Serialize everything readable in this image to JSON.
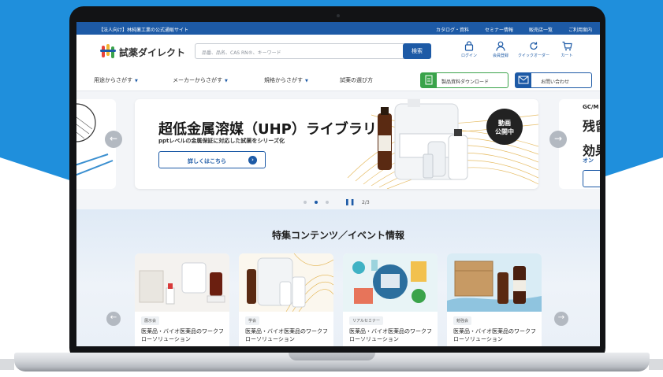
{
  "colors": {
    "brand_blue": "#1d5aa6",
    "accent_green": "#3aa34a",
    "backdrop_blue": "#1f8fdc"
  },
  "topbar": {
    "site_label": "【法人向け】林純薬工業の公式通販サイト",
    "links": [
      "カタログ・資料",
      "セミナー情報",
      "販売店一覧",
      "ご利用案内"
    ]
  },
  "header": {
    "logo_text": "試薬ダイレクト",
    "search_placeholder": "品番、品名、CAS RN®、キーワード",
    "search_button": "検索",
    "icons": [
      {
        "icon": "lock-icon",
        "label": "ログイン"
      },
      {
        "icon": "user-icon",
        "label": "会員登録"
      },
      {
        "icon": "reorder-icon",
        "label": "クイックオーダー"
      },
      {
        "icon": "cart-icon",
        "label": "カート"
      }
    ]
  },
  "nav": {
    "items": [
      "用途からさがす",
      "メーカーからさがす",
      "規格からさがす",
      "試薬の選び方"
    ],
    "download_button": "製品資料ダウンロード",
    "contact_button": "お問い合わせ"
  },
  "hero": {
    "title": "超低金属溶媒（UHP）ライブラリ",
    "subtitle": "pptレベルの金属保証に対応した試薬をシリーズ化",
    "button": "詳しくはこちら",
    "badge_line1": "動画",
    "badge_line2": "公開中",
    "next_slide": {
      "line1": "GC/M",
      "line2": "残留",
      "line3": "効果",
      "line4": "オン"
    },
    "pager_text": "2/3",
    "current_slide": 2,
    "total_slides": 3
  },
  "features": {
    "title": "特集コンテンツ／イベント情報",
    "cards": [
      {
        "tag": "展示会",
        "title": "医薬品・バイオ医薬品のワークフローソリューション"
      },
      {
        "tag": "学会",
        "title": "医薬品・バイオ医薬品のワークフローソリューション"
      },
      {
        "tag": "リアルセミナー",
        "title": "医薬品・バイオ医薬品のワークフローソリューション"
      },
      {
        "tag": "勉強会",
        "title": "医薬品・バイオ医薬品のワークフローソリューション"
      }
    ]
  }
}
